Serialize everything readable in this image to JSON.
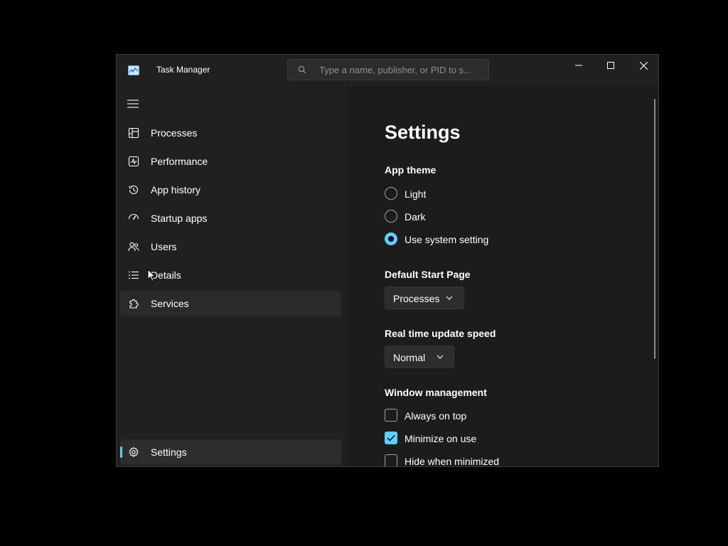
{
  "window": {
    "title": "Task Manager",
    "search_placeholder": "Type a name, publisher, or PID to s..."
  },
  "sidebar": {
    "items": [
      {
        "label": "Processes",
        "icon": "processes-icon"
      },
      {
        "label": "Performance",
        "icon": "performance-icon"
      },
      {
        "label": "App history",
        "icon": "history-icon"
      },
      {
        "label": "Startup apps",
        "icon": "startup-icon"
      },
      {
        "label": "Users",
        "icon": "users-icon"
      },
      {
        "label": "Details",
        "icon": "details-list-icon"
      },
      {
        "label": "Services",
        "icon": "services-puzzle-icon"
      }
    ],
    "settings_label": "Settings",
    "hovered_item": "Services",
    "selected_item": "Settings"
  },
  "settings": {
    "title": "Settings",
    "app_theme": {
      "label": "App theme",
      "options": [
        "Light",
        "Dark",
        "Use system setting"
      ],
      "selected": "Use system setting"
    },
    "default_start_page": {
      "label": "Default Start Page",
      "value": "Processes"
    },
    "update_speed": {
      "label": "Real time update speed",
      "value": "Normal"
    },
    "window_management": {
      "label": "Window management",
      "options": [
        {
          "label": "Always on top",
          "checked": false
        },
        {
          "label": "Minimize on use",
          "checked": true
        },
        {
          "label": "Hide when minimized",
          "checked": false
        }
      ]
    }
  },
  "colors": {
    "accent": "#60cdff",
    "background": "#1c1c1c",
    "sidebar": "#202020"
  }
}
